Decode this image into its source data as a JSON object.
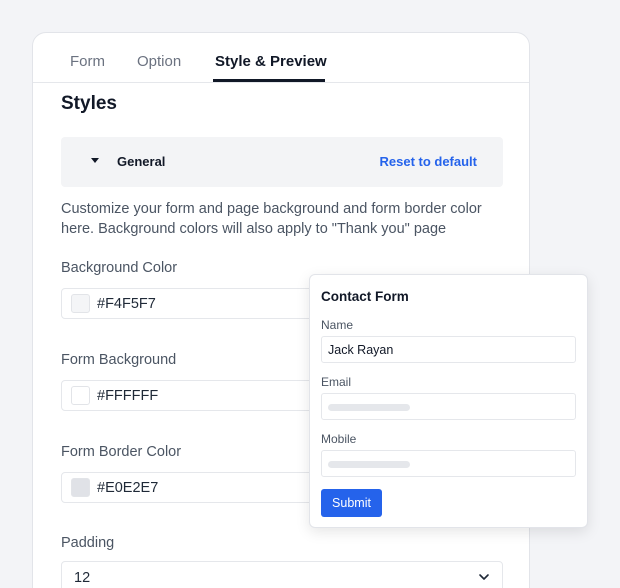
{
  "tabs": [
    {
      "label": "Form",
      "active": false
    },
    {
      "label": "Option",
      "active": false
    },
    {
      "label": "Style & Preview",
      "active": true
    }
  ],
  "styles": {
    "title": "Styles",
    "accordion": {
      "title": "General",
      "reset_label": "Reset to default",
      "expanded": true
    },
    "description": "Customize your form and page background and form border color here. Background colors will also apply to \"Thank you\" page",
    "fields": [
      {
        "label": "Background Color",
        "value": "#F4F5F7",
        "swatch": "#F4F5F7"
      },
      {
        "label": "Form Background",
        "value": "#FFFFFF",
        "swatch": "#FFFFFF"
      },
      {
        "label": "Form Border Color",
        "value": "#E0E2E7",
        "swatch": "#E0E2E7"
      }
    ],
    "padding": {
      "label": "Padding",
      "value": "12"
    }
  },
  "preview": {
    "title": "Contact Form",
    "fields": [
      {
        "label": "Name",
        "value": "Jack Rayan"
      },
      {
        "label": "Email",
        "value": ""
      },
      {
        "label": "Mobile",
        "value": ""
      }
    ],
    "submit_label": "Submit",
    "accent": "#2563EB"
  },
  "icons": {
    "accordion": "caret-down-icon",
    "select": "chevron-down-icon"
  }
}
